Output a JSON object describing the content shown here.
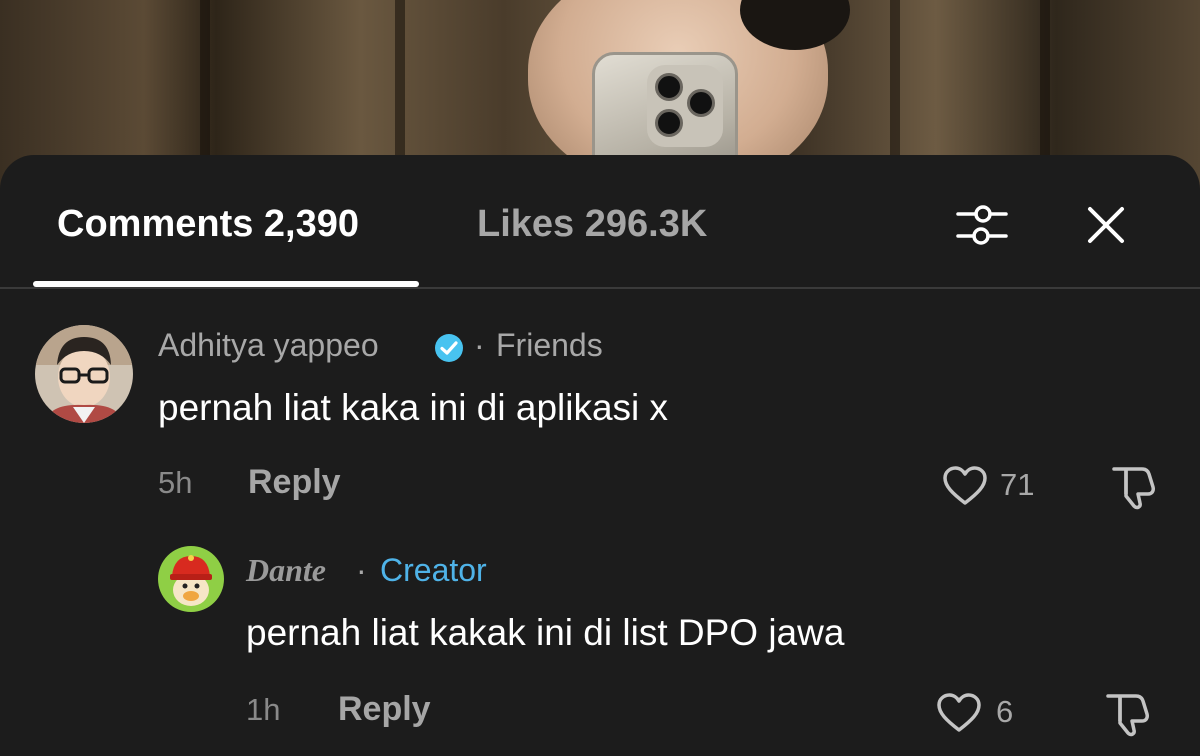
{
  "tabs": {
    "comments_label": "Comments 2,390",
    "likes_label": "Likes 296.3K"
  },
  "header_icons": {
    "filter": "filter-sliders-icon",
    "close": "close-icon"
  },
  "comments": [
    {
      "username": "Adhitya yappeo",
      "verified": true,
      "badge_color": "#48c3f0",
      "relation_sep": "·",
      "relation": "Friends",
      "text": "pernah liat kaka ini di aplikasi x",
      "time": "5h",
      "reply_label": "Reply",
      "likes": "71"
    },
    {
      "username": "Dante",
      "relation_sep": "·",
      "relation": "Creator",
      "relation_color": "#4fb3e8",
      "text": "pernah liat kakak ini di list DPO jawa",
      "time": "1h",
      "reply_label": "Reply",
      "likes": "6"
    }
  ],
  "colors": {
    "background": "#1c1c1c",
    "primary_text": "#ffffff",
    "secondary_text": "#a8a8a8",
    "creator_blue": "#4fb3e8"
  }
}
